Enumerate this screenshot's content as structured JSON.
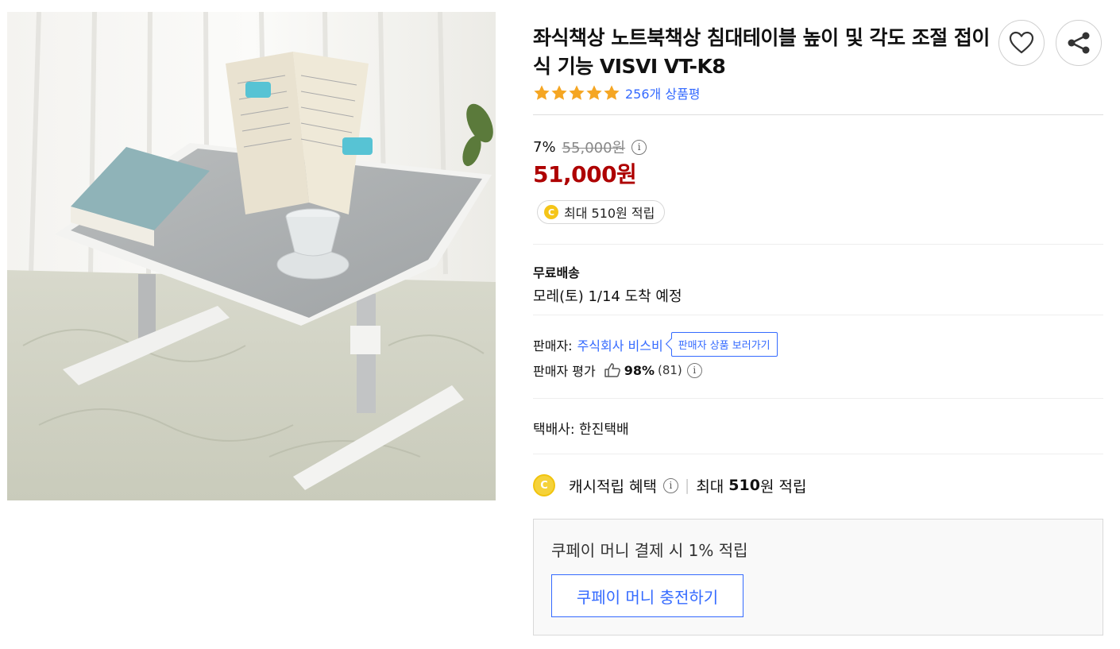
{
  "product": {
    "title": "좌식책상 노트북책상 침대테이블 높이 및 각도 조절 접이식 기능 VISVI VT-K8",
    "rating": {
      "stars": 5,
      "review_text": "256개 상품평"
    },
    "discount_rate": "7%",
    "original_price": "55,000원",
    "sale_price": "51,000원",
    "reward_pill": "최대 510원 적립",
    "coin_letter": "C"
  },
  "shipping": {
    "title": "무료배송",
    "arrival": "모레(토) 1/14 도착 예정"
  },
  "seller": {
    "label": "판매자:",
    "name": "주식회사 비스비",
    "link_label": "판매자 상품 보러가기",
    "rating_label": "판매자 평가",
    "rating_pct": "98%",
    "rating_count": "(81)"
  },
  "courier": "택배사: 한진택배",
  "cash": {
    "label": "캐시적립 혜택",
    "prefix": "최대",
    "amount": "510",
    "suffix": "원 적립"
  },
  "coupay": {
    "text": "쿠페이 머니 결제 시 1% 적립",
    "button": "쿠페이 머니 충전하기"
  },
  "icons": {
    "wish": "heart-icon",
    "share": "share-icon",
    "info": "i"
  },
  "colors": {
    "accent": "#346aff",
    "price": "#ae0000",
    "star": "#f5a623",
    "coin": "#f5c518"
  }
}
